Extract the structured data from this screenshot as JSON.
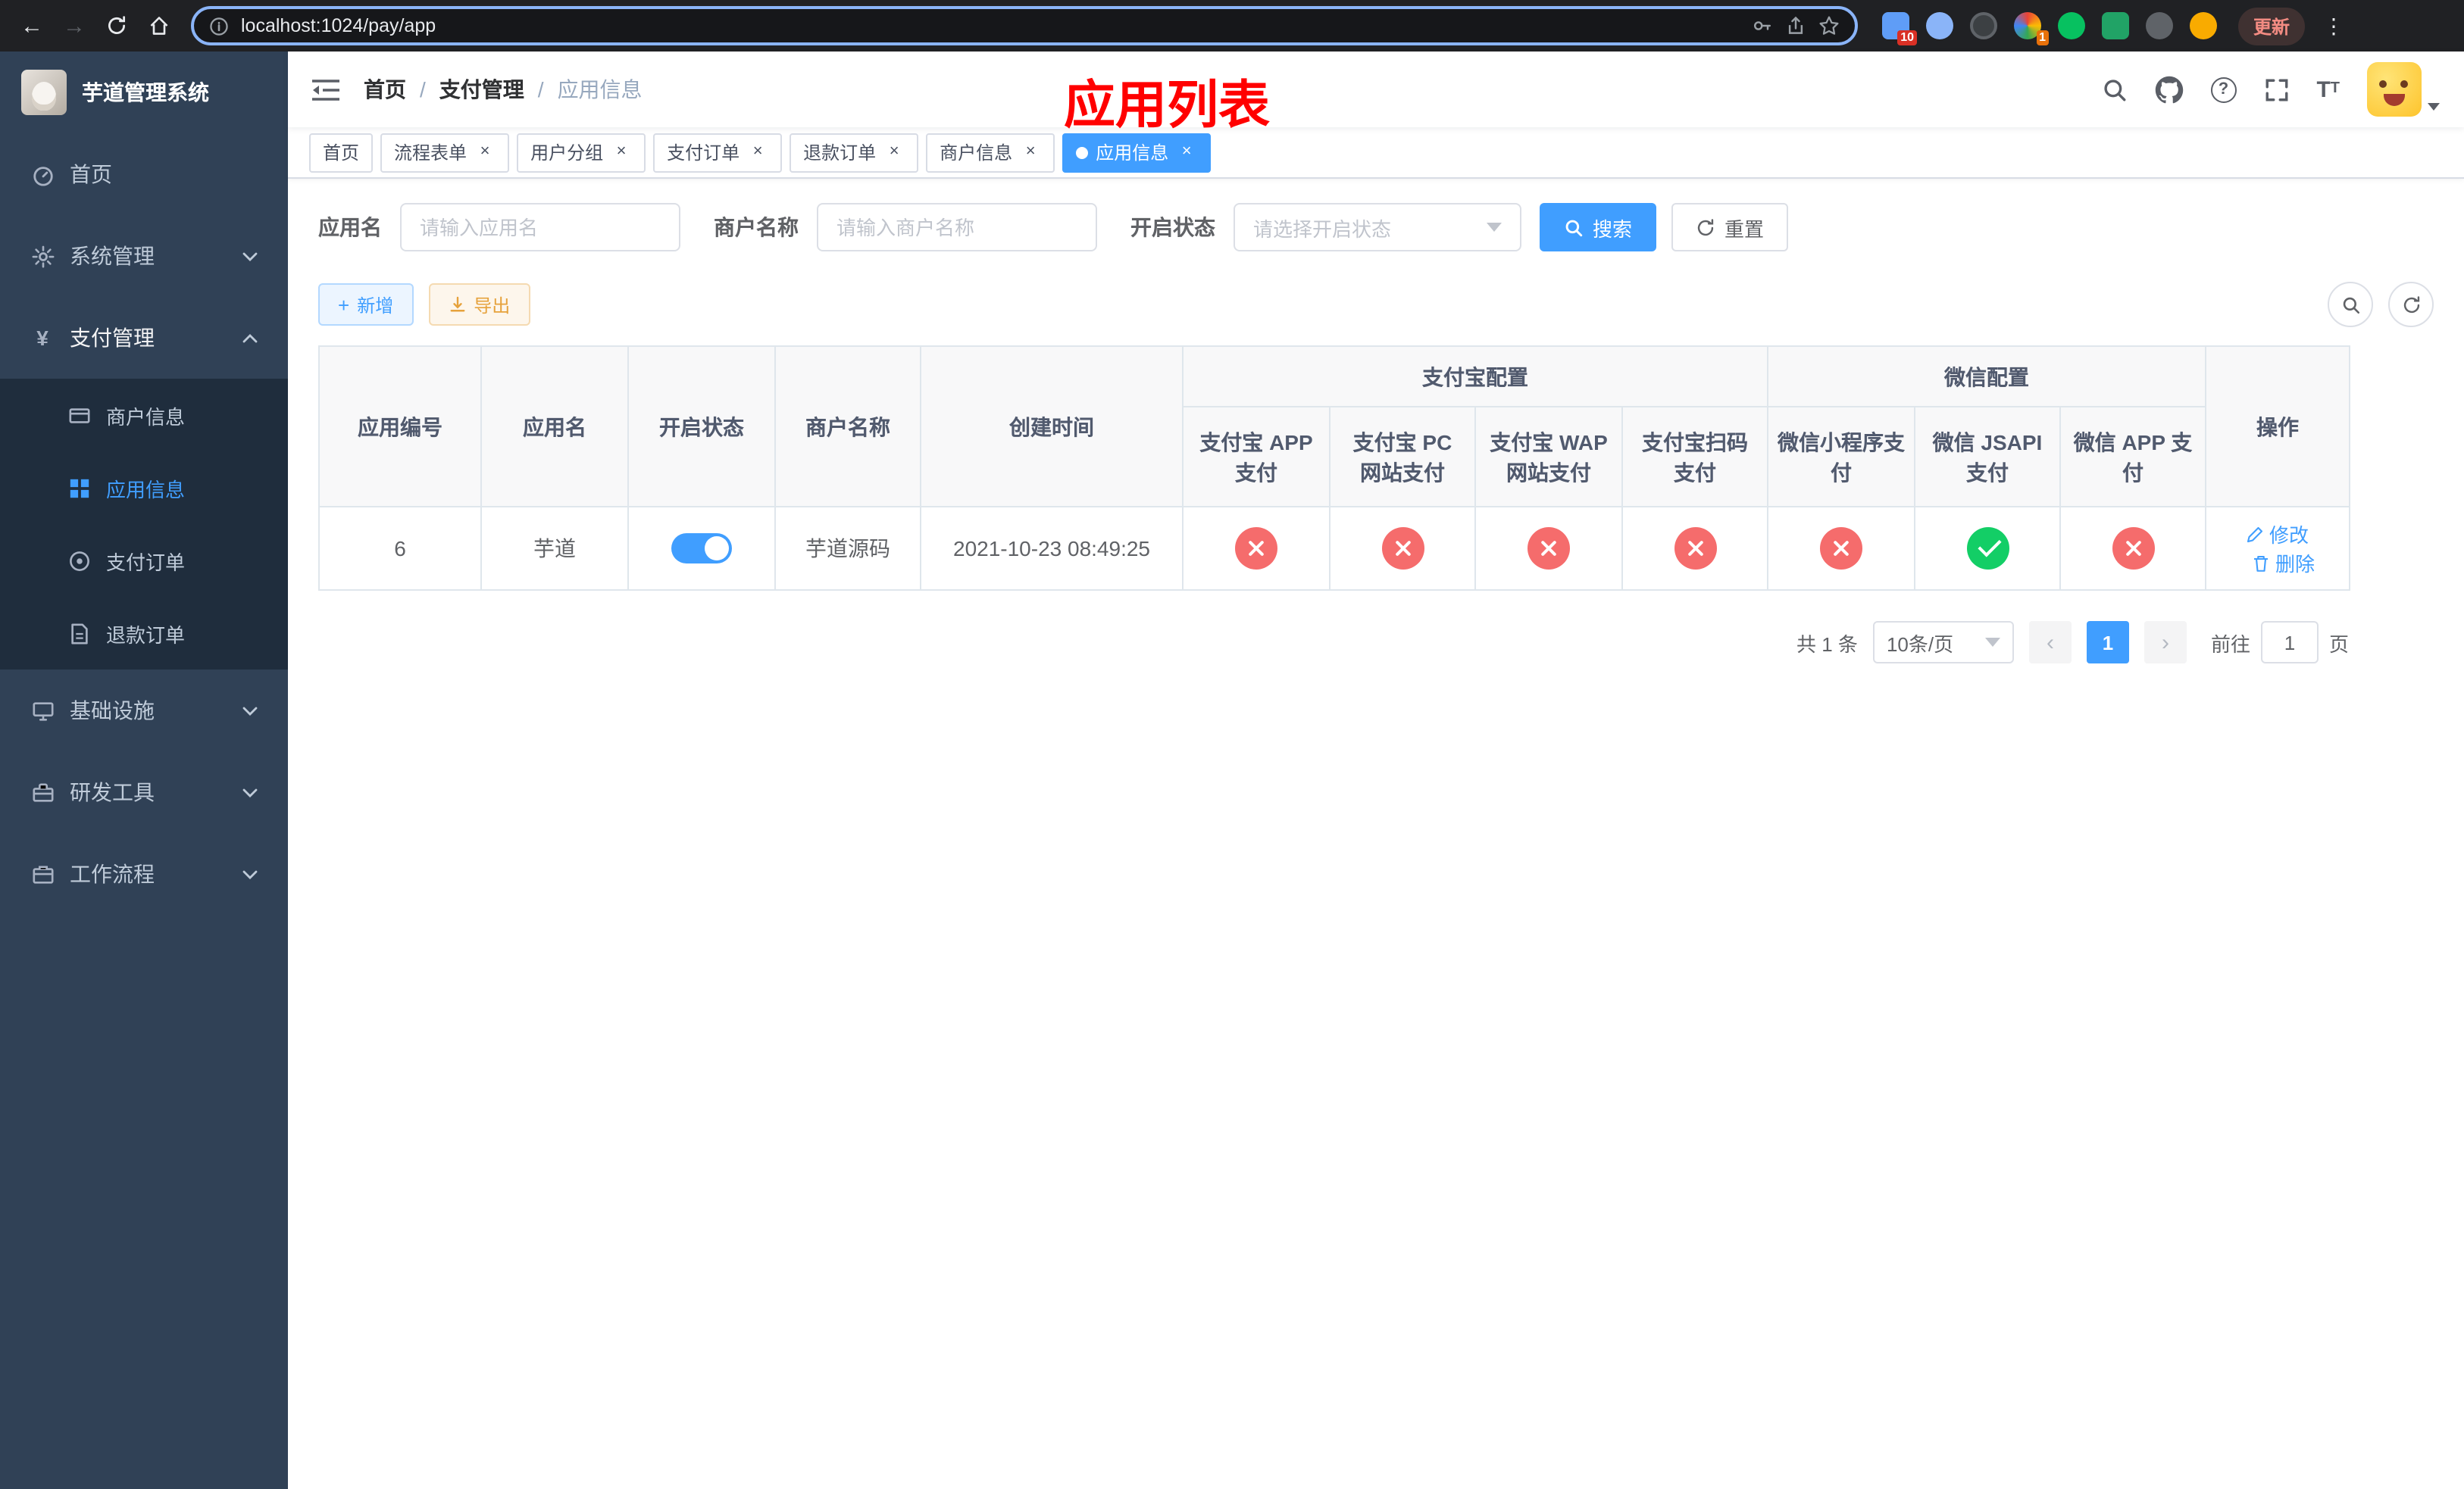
{
  "browser": {
    "url": "localhost:1024/pay/app",
    "update_label": "更新",
    "extension_badge_a": "10",
    "extension_badge_b": "1"
  },
  "sidebar": {
    "title": "芋道管理系统",
    "menu_home": "首页",
    "menu_system": "系统管理",
    "menu_payment": "支付管理",
    "submenu_merchant": "商户信息",
    "submenu_app": "应用信息",
    "submenu_pay_order": "支付订单",
    "submenu_refund_order": "退款订单",
    "menu_infra": "基础设施",
    "menu_devtools": "研发工具",
    "menu_workflow": "工作流程"
  },
  "navbar": {
    "breadcrumb": [
      "首页",
      "支付管理",
      "应用信息"
    ],
    "overlay_title": "应用列表"
  },
  "tabs": [
    {
      "label": "首页"
    },
    {
      "label": "流程表单"
    },
    {
      "label": "用户分组"
    },
    {
      "label": "支付订单"
    },
    {
      "label": "退款订单"
    },
    {
      "label": "商户信息"
    },
    {
      "label": "应用信息"
    }
  ],
  "filters": {
    "app_name_label": "应用名",
    "app_name_placeholder": "请输入应用名",
    "merchant_label": "商户名称",
    "merchant_placeholder": "请输入商户名称",
    "status_label": "开启状态",
    "status_placeholder": "请选择开启状态",
    "search_label": "搜索",
    "reset_label": "重置"
  },
  "toolbar": {
    "add_label": "新增",
    "export_label": "导出"
  },
  "table": {
    "headers": {
      "app_id": "应用编号",
      "app_name": "应用名",
      "status": "开启状态",
      "merchant_name": "商户名称",
      "created_at": "创建时间",
      "alipay_group": "支付宝配置",
      "wechat_group": "微信配置",
      "alipay_app": "支付宝 APP 支付",
      "alipay_pc": "支付宝 PC 网站支付",
      "alipay_wap": "支付宝 WAP 网站支付",
      "alipay_qr": "支付宝扫码支付",
      "wechat_lite": "微信小程序支付",
      "wechat_jsapi": "微信 JSAPI 支付",
      "wechat_app": "微信 APP 支付",
      "actions": "操作"
    },
    "rows": [
      {
        "app_id": "6",
        "app_name": "芋道",
        "status_enabled": true,
        "merchant_name": "芋道源码",
        "created_at": "2021-10-23 08:49:25",
        "alipay_app": "disabled",
        "alipay_pc": "disabled",
        "alipay_wap": "disabled",
        "alipay_qr": "disabled",
        "wechat_lite": "disabled",
        "wechat_jsapi": "enabled",
        "wechat_app": "disabled",
        "action_edit": "修改",
        "action_delete": "删除"
      }
    ]
  },
  "pagination": {
    "total_text": "共 1 条",
    "page_size_text": "10条/页",
    "current_page": "1",
    "goto_prefix": "前往",
    "goto_value": "1",
    "goto_suffix": "页"
  },
  "colors": {
    "primary": "#409eff",
    "success": "#13ce66",
    "danger": "#f56c6c",
    "warning": "#e6a23c",
    "sidebar_bg": "#304156",
    "submenu_bg": "#1f2d3d",
    "overlay_title_color": "#ff0000"
  }
}
